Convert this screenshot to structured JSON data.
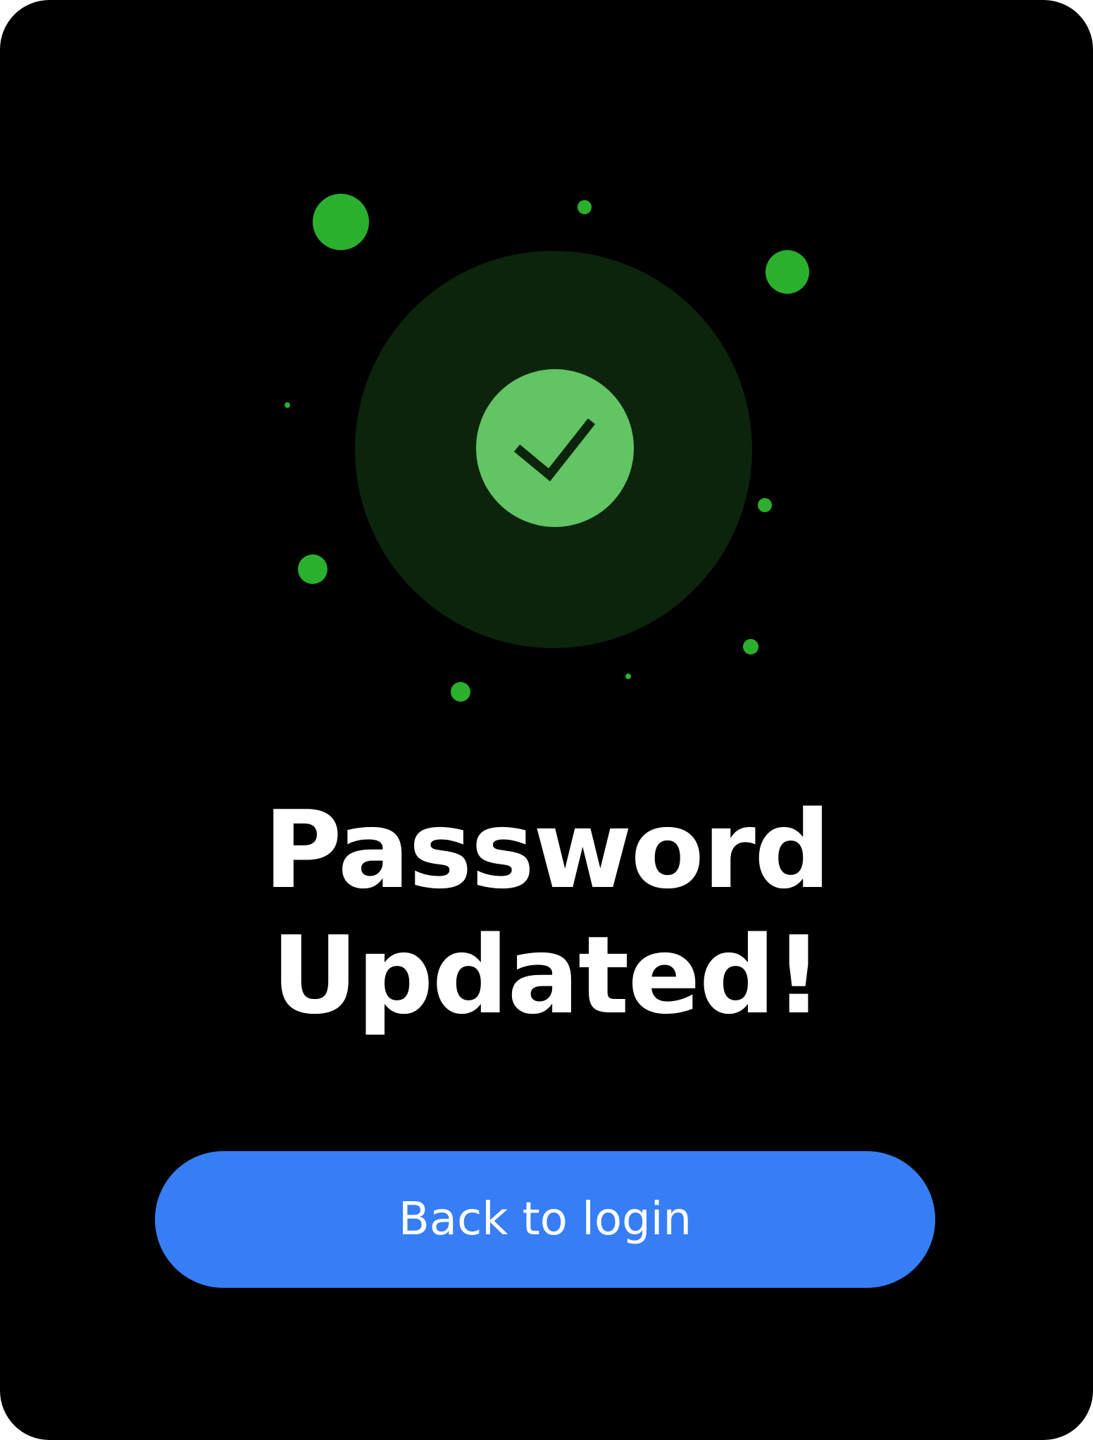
{
  "dialog": {
    "icon": "check-circle-icon",
    "title_line1": "Password",
    "title_line2": "Updated!",
    "back_button_label": "Back to login"
  },
  "colors": {
    "background": "#000000",
    "halo": "#0b240b",
    "check_circle": "#62c464",
    "check_mark": "#0b240b",
    "confetti": "#2ab02d",
    "button": "#377ef6",
    "text": "#ffffff"
  }
}
